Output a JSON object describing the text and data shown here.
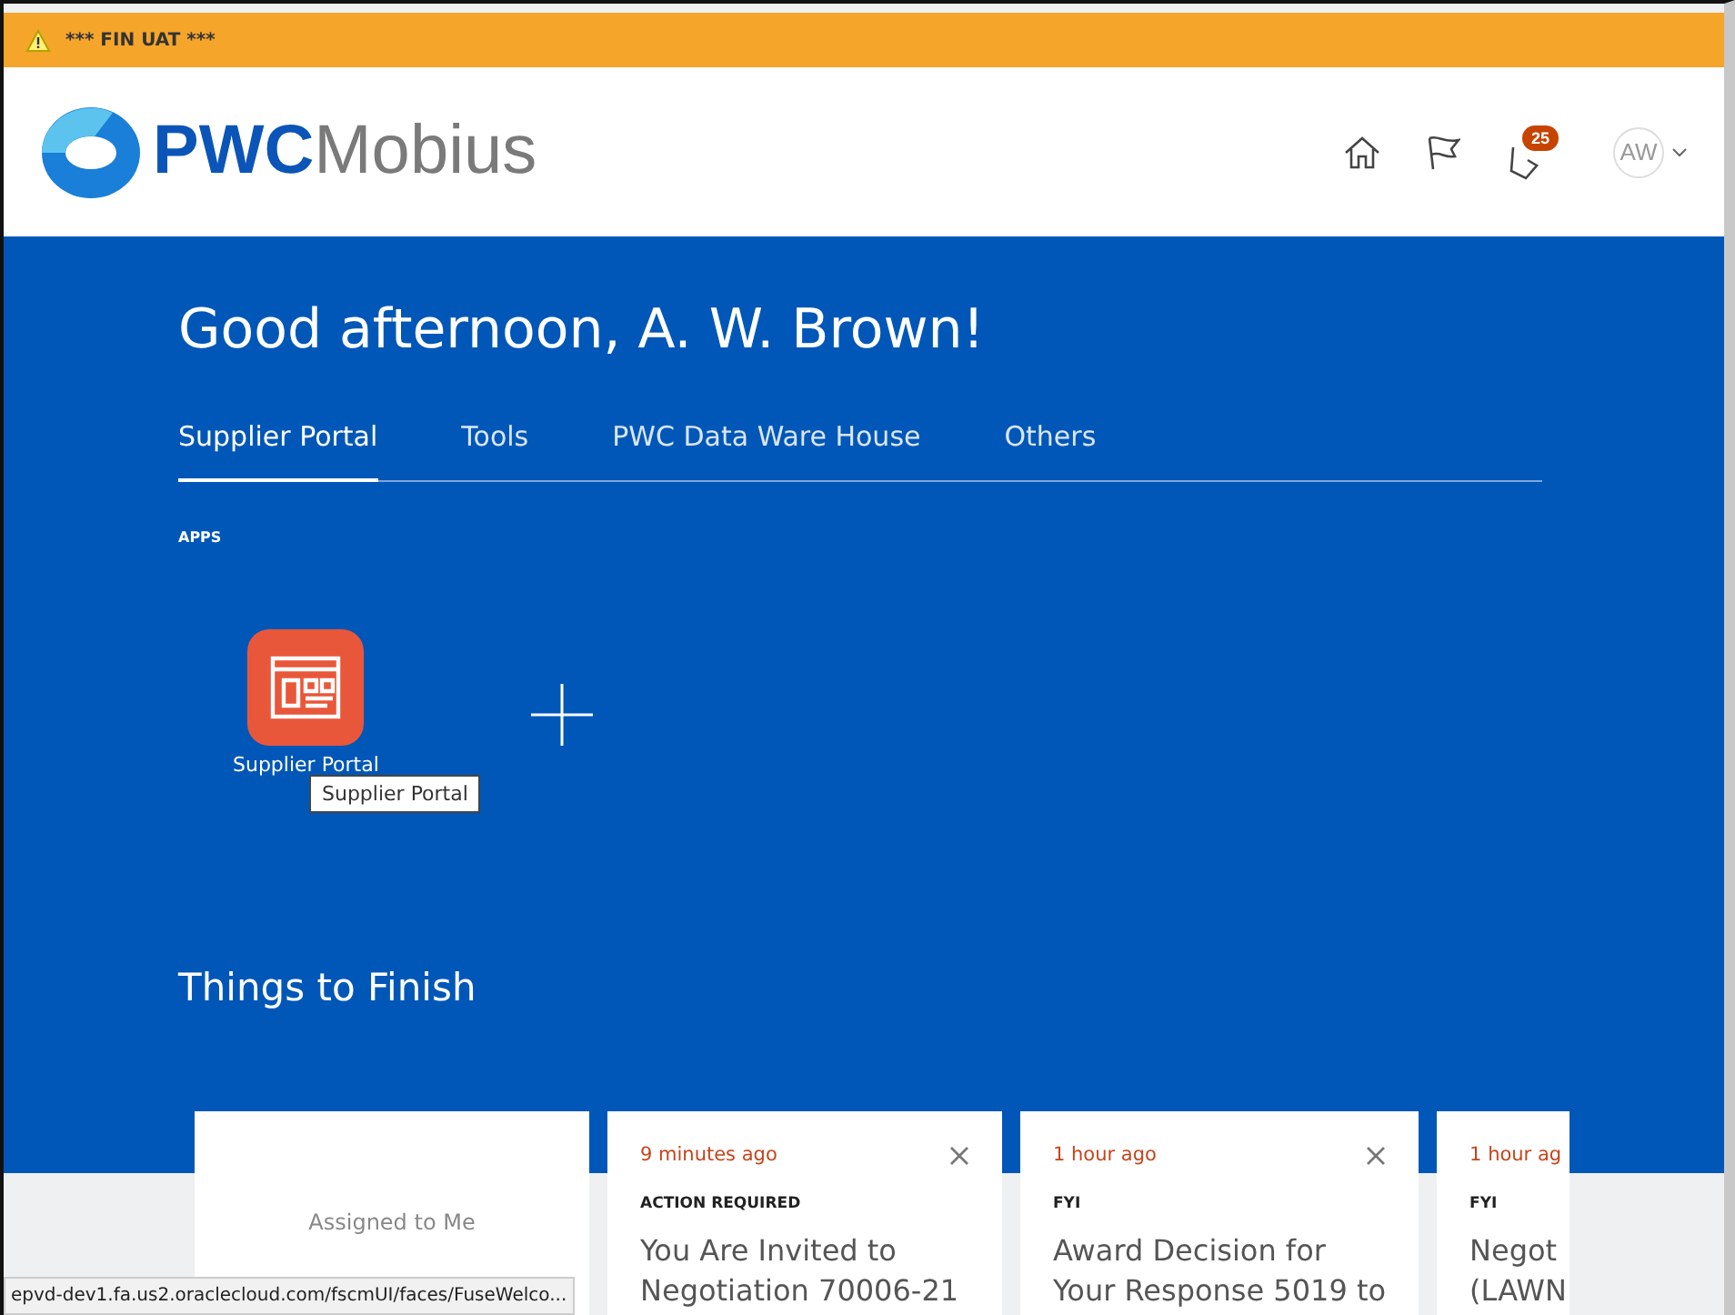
{
  "env_banner": {
    "text": "*** FIN UAT ***"
  },
  "header": {
    "logo_bold": "PWC",
    "logo_light": "Mobius",
    "notification_count": "25",
    "avatar": "AW"
  },
  "greeting": "Good afternoon, A. W. Brown!",
  "tabs": [
    {
      "label": "Supplier Portal",
      "selected": true
    },
    {
      "label": "Tools",
      "selected": false
    },
    {
      "label": "PWC Data Ware House",
      "selected": false
    },
    {
      "label": "Others",
      "selected": false
    }
  ],
  "apps_heading": "APPS",
  "apps": [
    {
      "label": "Supplier Portal",
      "tooltip": "Supplier Portal"
    }
  ],
  "things_heading": "Things to Finish",
  "summary_card": {
    "label": "Assigned to Me"
  },
  "cards": [
    {
      "time": "9 minutes ago",
      "type": "ACTION REQUIRED",
      "title": [
        "You Are Invited to",
        "Negotiation 70006-21"
      ],
      "closable": true
    },
    {
      "time": "1 hour ago",
      "type": "FYI",
      "title": [
        "Award Decision for",
        "Your Response 5019 to"
      ],
      "closable": true
    },
    {
      "time": "1 hour ag",
      "type": "FYI",
      "title": [
        "Negot",
        "(LAWN"
      ],
      "closable": false
    }
  ],
  "status_url": "epvd-dev1.fa.us2.oraclecloud.com/fscmUI/faces/FuseWelco..."
}
